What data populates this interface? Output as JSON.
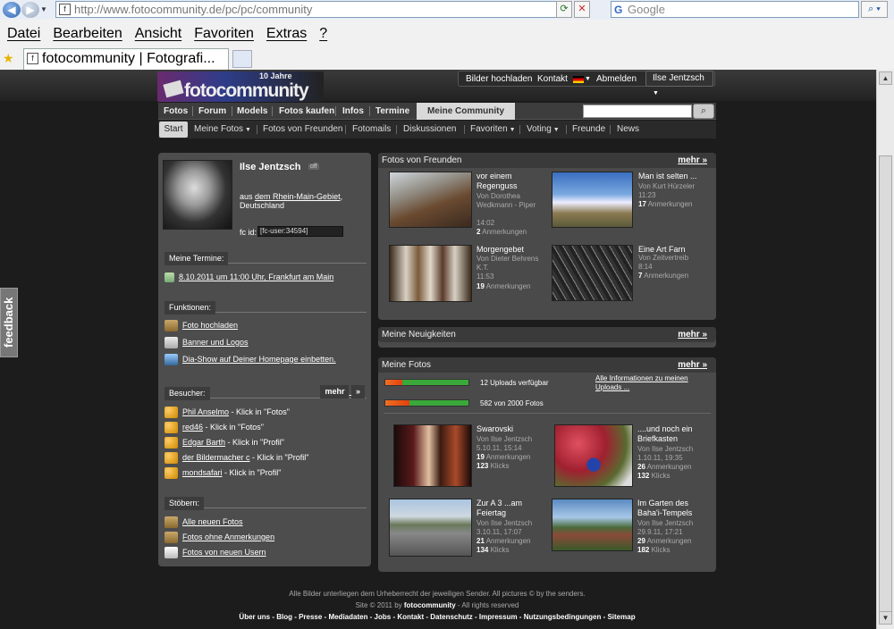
{
  "browser": {
    "address_url": "http://www.fotocommunity.de/pc/pc/community",
    "search_placeholder": "Google",
    "menu": [
      "Datei",
      "Bearbeiten",
      "Ansicht",
      "Favoriten",
      "Extras",
      "?"
    ],
    "tab_title": "fotocommunity | Fotografi..."
  },
  "feedback_label": "feedback",
  "header": {
    "logo_tag": "10 Jahre",
    "logo_word": "fotocommunity",
    "upload_label": "Bilder hochladen",
    "contact_label": "Kontakt",
    "logout_label": "Abmelden",
    "user_label": "Ilse Jentzsch"
  },
  "mainnav": [
    "Fotos",
    "Forum",
    "Models",
    "Fotos kaufen",
    "Infos",
    "Termine"
  ],
  "mainnav_active": "Meine Community",
  "subnav": {
    "start": "Start",
    "items": [
      "Meine Fotos",
      "Fotos von Freunden",
      "Fotomails",
      "Diskussionen",
      "Favoriten",
      "Voting",
      "Freunde",
      "News"
    ]
  },
  "profile": {
    "name": "Ilse Jentzsch",
    "status": "off",
    "from_prefix": "aus",
    "region": "dem Rhein-Main-Gebiet",
    "country": ", Deutschland",
    "fcid_label": "fc id:",
    "fcid_value": "[fc-user:34594]"
  },
  "termine": {
    "title": "Meine Termine:",
    "item": "8.10.2011 um 11:00 Uhr, Frankfurt am Main"
  },
  "funktionen": {
    "title": "Funktionen:",
    "items": [
      "Foto hochladen",
      "Banner und Logos",
      "Dia-Show auf Deiner Homepage einbetten."
    ]
  },
  "besucher": {
    "title": "Besucher:",
    "mehr": "mehr",
    "items": [
      {
        "name": "Phil Anselmo",
        "action": " - Klick in \"Fotos\""
      },
      {
        "name": "red46",
        "action": " - Klick in \"Fotos\""
      },
      {
        "name": "Edgar Barth",
        "action": " - Klick in \"Profil\""
      },
      {
        "name": "der Bildermacher c",
        "action": " - Klick in \"Profil\""
      },
      {
        "name": "mondsafari",
        "action": " - Klick in \"Profil\""
      }
    ]
  },
  "stoebern": {
    "title": "Stöbern:",
    "items": [
      "Alle neuen Fotos",
      "Fotos ohne Anmerkungen",
      "Fotos von neuen Usern"
    ]
  },
  "friends": {
    "title": "Fotos von Freunden",
    "mehr": "mehr",
    "photos": [
      {
        "title": "vor einem Regenguss",
        "by": "Von Dorothea Wedkmann - Piper",
        "time": "14:02",
        "count": "2",
        "unit": "Anmerkungen"
      },
      {
        "title": "Man ist selten ...",
        "by": "Von Kurt Hürzeler",
        "time": "11:23",
        "count": "17",
        "unit": "Anmerkungen"
      },
      {
        "title": "Morgengebet",
        "by": "Von Dieter Behrens K.T.",
        "time": "11:53",
        "count": "19",
        "unit": "Anmerkungen"
      },
      {
        "title": "Eine Art Farn",
        "by": "Von Zeitvertreib",
        "time": "8:14",
        "count": "7",
        "unit": "Anmerkungen"
      }
    ]
  },
  "news": {
    "title": "Meine Neuigkeiten",
    "mehr": "mehr"
  },
  "myfotos": {
    "title": "Meine Fotos",
    "mehr": "mehr",
    "uploads_text": "12 Uploads verfügbar",
    "uploads_fraction": 0.2,
    "fotos_text": "582 von 2000 Fotos",
    "fotos_fraction": 0.29,
    "info_link": "Alle Informationen zu meinen Uploads ...",
    "photos": [
      {
        "title": "Swarovski",
        "by": "Von Ilse Jentzsch",
        "date": "5.10.11, 15:14",
        "count": "19",
        "unit": "Anmerkungen",
        "clicks": "123",
        "clicks_unit": "Klicks"
      },
      {
        "title": "....und noch ein Briefkasten",
        "by": "Von Ilse Jentzsch",
        "date": "1.10.11, 19:35",
        "count": "26",
        "unit": "Anmerkungen",
        "clicks": "132",
        "clicks_unit": "Klicks"
      },
      {
        "title": "Zur A 3 ...am Feiertag",
        "by": "Von Ilse Jentzsch",
        "date": "3.10.11, 17:07",
        "count": "21",
        "unit": "Anmerkungen",
        "clicks": "134",
        "clicks_unit": "Klicks"
      },
      {
        "title": "Im Garten des Baha'i-Tempels",
        "by": "Von Ilse Jentzsch",
        "date": "29.9.11, 17:21",
        "count": "29",
        "unit": "Anmerkungen",
        "clicks": "182",
        "clicks_unit": "Klicks"
      }
    ]
  },
  "footer": {
    "copyright": "Alle Bilder unterliegen dem Urheberrecht der jeweiligen Sender. All pictures © by the senders.",
    "site_prefix": "Site © 2011 by ",
    "site_name": "fotocommunity",
    "site_suffix": " - All rights reserved",
    "links": "Über uns - Blog - Presse - Mediadaten - Jobs - Kontakt - Datenschutz - Impressum - Nutzungsbedingungen - Sitemap"
  }
}
